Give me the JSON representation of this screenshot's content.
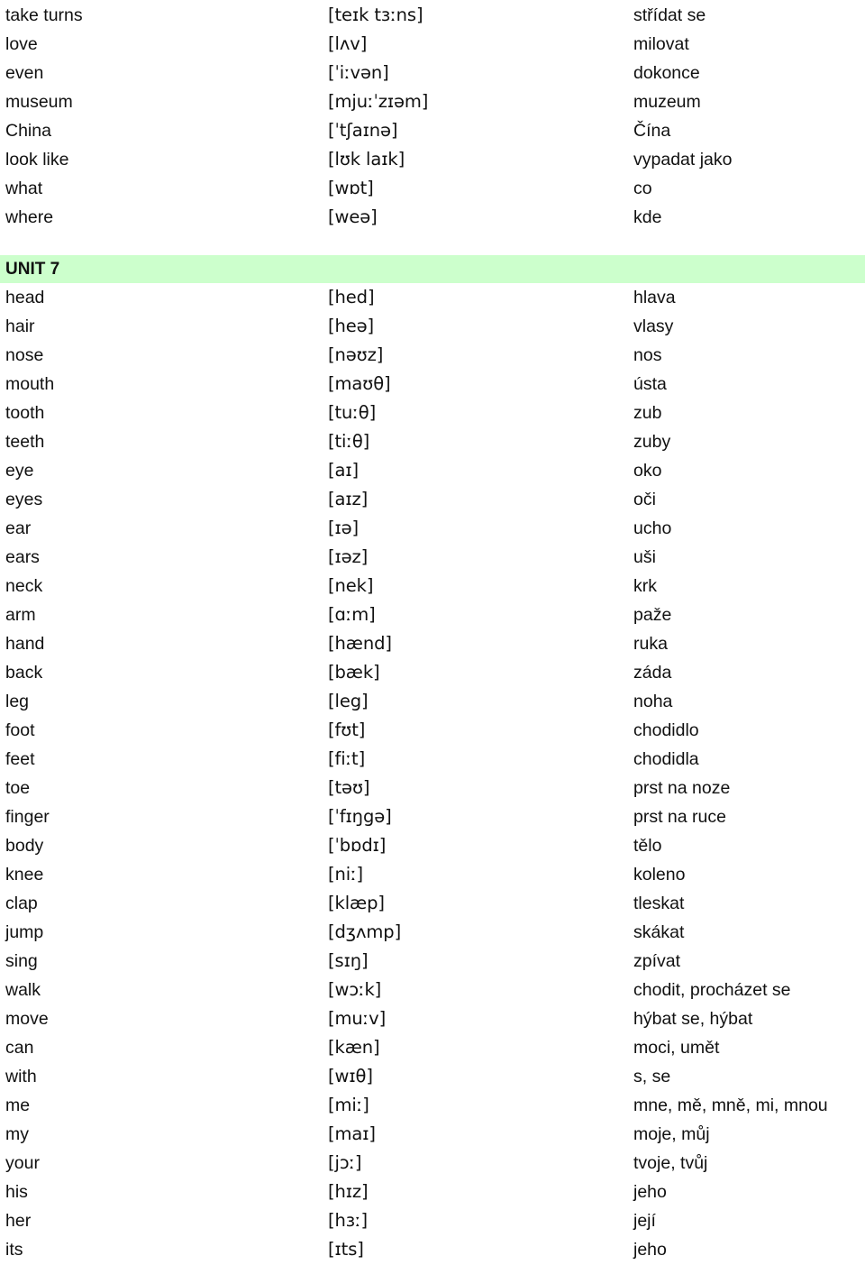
{
  "document": {
    "type": "vocabulary-wordlist",
    "languages": {
      "source": "English",
      "ipa": "IPA",
      "target": "Czech"
    },
    "accent_color": "#CCFFCC",
    "text_color": "#111111"
  },
  "blocks": [
    {
      "kind": "entries",
      "rows": [
        {
          "term": "take turns",
          "ipa": "[teɪk tɜːns]",
          "translation": "střídat se"
        },
        {
          "term": "love",
          "ipa": "[lʌv]",
          "translation": "milovat"
        },
        {
          "term": "even",
          "ipa": "[ˈiːvən]",
          "translation": "dokonce"
        },
        {
          "term": "museum",
          "ipa": "[mjuːˈzɪəm]",
          "translation": "muzeum"
        },
        {
          "term": "China",
          "ipa": "[ˈtʃaɪnə]",
          "translation": "Čína"
        },
        {
          "term": "look like",
          "ipa": "[lʊk laɪk]",
          "translation": "vypadat jako"
        },
        {
          "term": "what",
          "ipa": "[wɒt]",
          "translation": "co"
        },
        {
          "term": "where",
          "ipa": "[weə]",
          "translation": "kde"
        }
      ]
    },
    {
      "kind": "section",
      "label": "UNIT 7"
    },
    {
      "kind": "entries",
      "rows": [
        {
          "term": "head",
          "ipa": "[hed]",
          "translation": "hlava"
        },
        {
          "term": "hair",
          "ipa": "[heə]",
          "translation": "vlasy"
        },
        {
          "term": "nose",
          "ipa": "[nəʊz]",
          "translation": "nos"
        },
        {
          "term": "mouth",
          "ipa": "[maʊθ]",
          "translation": "ústa"
        },
        {
          "term": "tooth",
          "ipa": "[tuːθ]",
          "translation": "zub"
        },
        {
          "term": "teeth",
          "ipa": "[tiːθ]",
          "translation": "zuby"
        },
        {
          "term": "eye",
          "ipa": "[aɪ]",
          "translation": "oko"
        },
        {
          "term": "eyes",
          "ipa": "[aɪz]",
          "translation": "oči"
        },
        {
          "term": "ear",
          "ipa": "[ɪə]",
          "translation": "ucho"
        },
        {
          "term": "ears",
          "ipa": "[ɪəz]",
          "translation": "uši"
        },
        {
          "term": "neck",
          "ipa": "[nek]",
          "translation": "krk"
        },
        {
          "term": "arm",
          "ipa": "[ɑːm]",
          "translation": "paže"
        },
        {
          "term": "hand",
          "ipa": "[hænd]",
          "translation": "ruka"
        },
        {
          "term": "back",
          "ipa": "[bæk]",
          "translation": "záda"
        },
        {
          "term": "leg",
          "ipa": "[leg]",
          "translation": "noha"
        },
        {
          "term": "foot",
          "ipa": "[fʊt]",
          "translation": "chodidlo"
        },
        {
          "term": "feet",
          "ipa": "[fiːt]",
          "translation": "chodidla"
        },
        {
          "term": "toe",
          "ipa": "[təʊ]",
          "translation": "prst na noze"
        },
        {
          "term": "finger",
          "ipa": "[ˈfɪŋgə]",
          "translation": "prst na ruce"
        },
        {
          "term": "body",
          "ipa": "[ˈbɒdɪ]",
          "translation": "tělo"
        },
        {
          "term": "knee",
          "ipa": "[niː]",
          "translation": "koleno"
        },
        {
          "term": "clap",
          "ipa": "[klæp]",
          "translation": "tleskat"
        },
        {
          "term": "jump",
          "ipa": "[dʒʌmp]",
          "translation": "skákat"
        },
        {
          "term": "sing",
          "ipa": "[sɪŋ]",
          "translation": "zpívat"
        },
        {
          "term": "walk",
          "ipa": "[wɔːk]",
          "translation": "chodit, procházet se"
        },
        {
          "term": "move",
          "ipa": "[muːv]",
          "translation": "hýbat se, hýbat"
        },
        {
          "term": "can",
          "ipa": "[kæn]",
          "translation": "moci, umět"
        },
        {
          "term": "with",
          "ipa": "[wɪθ]",
          "translation": "s, se"
        },
        {
          "term": "me",
          "ipa": "[miː]",
          "translation": "mne, mě, mně, mi, mnou"
        },
        {
          "term": "my",
          "ipa": "[maɪ]",
          "translation": "moje, můj"
        },
        {
          "term": "your",
          "ipa": "[jɔː]",
          "translation": "tvoje, tvůj"
        },
        {
          "term": "his",
          "ipa": "[hɪz]",
          "translation": "jeho"
        },
        {
          "term": "her",
          "ipa": "[hɜː]",
          "translation": "její"
        },
        {
          "term": "its",
          "ipa": "[ɪts]",
          "translation": "jeho"
        }
      ]
    }
  ]
}
